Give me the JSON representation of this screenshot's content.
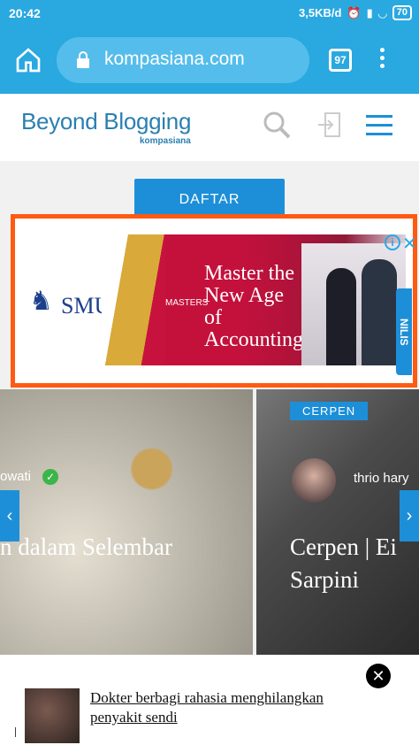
{
  "status": {
    "time": "20:42",
    "speed": "3,5KB/d",
    "battery": "70"
  },
  "browser": {
    "url": "kompasiana.com",
    "tab_count": "97"
  },
  "site": {
    "brand": "Beyond Blogging",
    "brand_sub": "kompasiana",
    "cta": "DAFTAR"
  },
  "ad": {
    "logo": "SMU",
    "tag": "MASTERS",
    "headline": "Master the New Age of Accounting",
    "side_label": "NILIS",
    "info": "i",
    "close": "✕"
  },
  "cards": [
    {
      "author": "owati",
      "title": "n dalam Selembar"
    },
    {
      "category": "CERPEN",
      "author": "thrio hary",
      "title": "Cerpen | Ei Sarpini"
    }
  ],
  "notification": {
    "text": "Dokter berbagi rahasia menghilangkan penyakit sendi",
    "close": "✕"
  },
  "footer_stub": "L"
}
